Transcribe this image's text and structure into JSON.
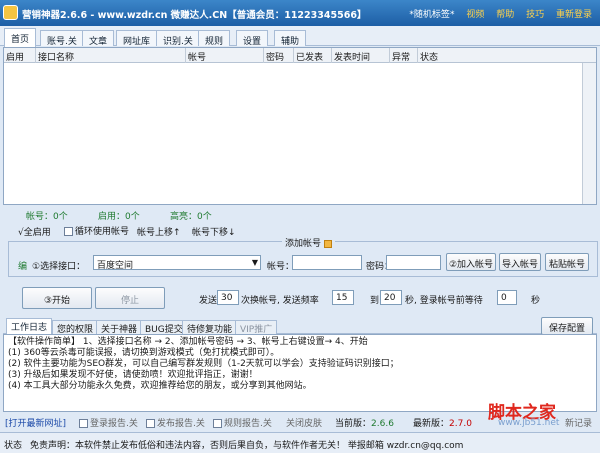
{
  "titlebar": {
    "title": "营销神器2.6.6 - www.wzdr.cn 微赚达人.CN【普通会员：11223345566】",
    "skin_label": "随机标签",
    "video": "视频",
    "help": "帮助",
    "tips": "技巧",
    "relogin": "重新登录"
  },
  "menu": {
    "tabs": [
      "首页",
      "账号.关",
      "文章",
      "网址库",
      "识别.关",
      "规则",
      "设置",
      "辅助"
    ]
  },
  "grid": {
    "columns": [
      "启用",
      "接口名称",
      "帐号",
      "密码",
      "已发表",
      "发表时间",
      "异常",
      "状态"
    ]
  },
  "stats": {
    "accounts": "帐号：0个",
    "enabled": "启用：0个",
    "highlighted": "高亮：0个"
  },
  "controls": {
    "select_all": "√全启用",
    "loop_use": "循环使用帐号",
    "move_up": "帐号上移↑",
    "move_down": "帐号下移↓"
  },
  "add_account": {
    "title": "添加帐号",
    "step_label": "编",
    "choose_label": "①选择接口：",
    "choose_value": "百度空间",
    "account_label": "帐号：",
    "password_label": "密码：",
    "add_btn": "②加入帐号",
    "import_btn": "导入帐号",
    "paste_btn": "粘贴帐号"
  },
  "run": {
    "start": "③开始",
    "stop": "停止",
    "send_label": "发送",
    "send_value": "30",
    "per_account": "次换帐号, 发送频率",
    "freq_from": "15",
    "to": "到",
    "freq_to": "20",
    "sec_wait": "秒, 登录帐号前等待",
    "wait_value": "0",
    "sec": "秒"
  },
  "bottom_tabs": [
    "工作日志",
    "您的权限",
    "关于神器",
    "BUG提交",
    "待修复功能",
    "VIP推广"
  ],
  "save_config": "保存配置",
  "log_lines": [
    "【软件操作简单】 1、选择接口名称 → 2、添加帐号密码 → 3、帐号上右键设置→ 4、开始",
    "(1) 360等云杀毒可能误报，请切换到游戏模式（免打扰模式即可）。",
    "(2) 软件主要功能为SEO群发，可以自己编写群发规则（1-2天就可以学会）支持验证码识别接口；",
    "(3) 升级后如果发现不好使，请使劲喷！欢迎批评指正，谢谢！",
    "(4) 本工具大部分功能永久免费，欢迎推荐给您的朋友，或分享到其他网站。"
  ],
  "footer": {
    "open_latest": "[打开最新网址]",
    "login_report": "登录报告.关",
    "publish_report": "发布报告.关",
    "rule_report": "规则报告.关",
    "close_skin": "关闭皮肤",
    "current_label": "当前版：",
    "current_ver": "2.6.6",
    "latest_label": "最新版：",
    "latest_ver": "2.7.0",
    "new_records": "新记录"
  },
  "status": {
    "label": "状态",
    "text": "免责声明：本软件禁止发布低俗和违法内容，否则后果自负，与软件作者无关！ 举报邮箱 wzdr.cn@qq.com"
  },
  "watermark": {
    "line1": "脚本之家",
    "line2": "www.jb51.net"
  }
}
